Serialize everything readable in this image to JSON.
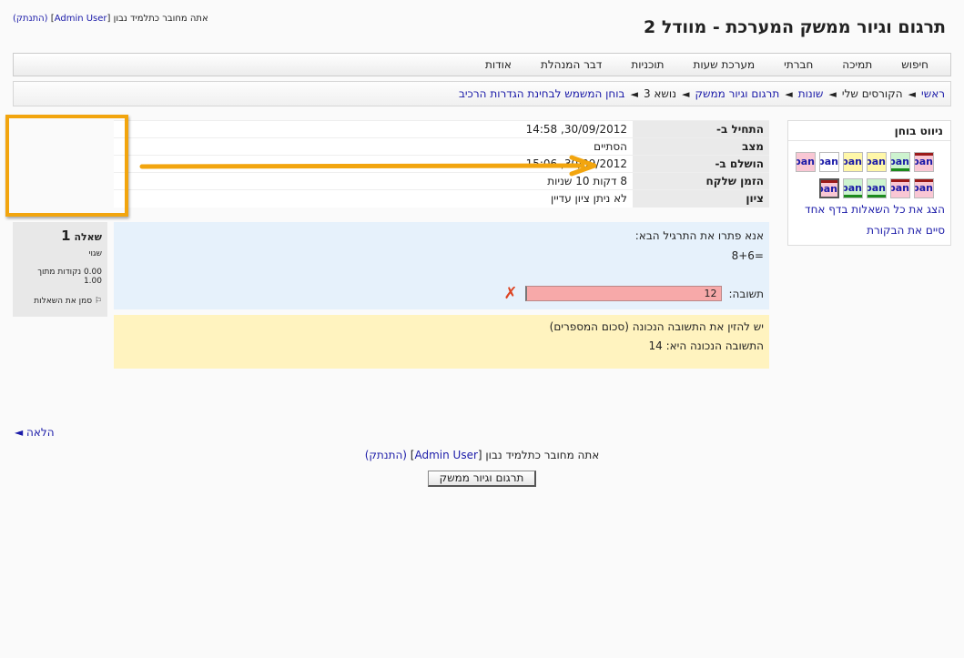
{
  "header": {
    "site_title": "תרגום וגיור ממשק המערכת - מוודל 2",
    "login_prefix": "אתה מחובר כתלמיד נבון",
    "login_user": "Admin User",
    "logout": "(התנתק)"
  },
  "menu": [
    "חיפוש",
    "תמיכה",
    "חברתי",
    "מערכת שעות",
    "תוכניות",
    "דבר המנהלת",
    "אודות"
  ],
  "breadcrumb": [
    "ראשי",
    "הקורסים שלי",
    "שונות",
    "תרגום וגיור ממשק",
    "נושא 3",
    "בוחן המשמש לבחינת הגדרות הרכיב"
  ],
  "quiz_nav": {
    "title": "ניווט בוחן",
    "buttons": [
      {
        "label": "pan",
        "bg": "#f9c7d4",
        "bar": "#9b1a1a",
        "bar_pos": "top"
      },
      {
        "label": "pan",
        "bg": "#cdf3cf",
        "bar": "#1c8a1c",
        "bar_pos": "bottom"
      },
      {
        "label": "pan",
        "bg": "#fff7a8",
        "bar": "",
        "bar_pos": ""
      },
      {
        "label": "pan",
        "bg": "#fff7a8",
        "bar": "",
        "bar_pos": ""
      },
      {
        "label": "pan",
        "bg": "#ffffff",
        "bar": "",
        "bar_pos": ""
      },
      {
        "label": "pan",
        "bg": "#f9c7d4",
        "bar": "",
        "bar_pos": ""
      },
      {
        "label": "pan",
        "bg": "#f9c7d4",
        "bar": "#9b1a1a",
        "bar_pos": "top"
      },
      {
        "label": "pan",
        "bg": "#f9c7d4",
        "bar": "#9b1a1a",
        "bar_pos": "top"
      },
      {
        "label": "pan",
        "bg": "#cdf3cf",
        "bar": "#1c8a1c",
        "bar_pos": "bottom"
      },
      {
        "label": "pan",
        "bg": "#cdf3cf",
        "bar": "#1c8a1c",
        "bar_pos": "bottom"
      },
      {
        "label": "pan",
        "bg": "#f9c7d4",
        "bar": "#9b1a1a",
        "bar_pos": "top"
      }
    ],
    "show_all": "הצג את כל השאלות בדף אחד",
    "finish_review": "סיים את הבקורת"
  },
  "summary": [
    {
      "label": "התחיל ב-",
      "value": "30/09/2012, 14:58"
    },
    {
      "label": "מצב",
      "value": "הסתיים"
    },
    {
      "label": "הושלם ב-",
      "value": "30/09/2012, 15:06"
    },
    {
      "label": "הזמן שלקח",
      "value": "8 דקות 10 שניות"
    },
    {
      "label": "ציון",
      "value": "לא ניתן ציון עדיין"
    }
  ],
  "question_info": {
    "label": "שאלה",
    "number": "1",
    "state": "שגוי",
    "grade": "0.00 נקודות מתוך 1.00",
    "flag": "סמן את השאלות"
  },
  "question": {
    "prompt": "אנא פתרו את התרגיל הבא:",
    "expression": "8+6=",
    "answer_label": "תשובה:",
    "answer_value": "12"
  },
  "feedback": {
    "general": "יש להזין את התשובה הנכונה (סכום המספרים)",
    "right_answer": "התשובה הנכונה היא: 14"
  },
  "footer": {
    "next": "הלאה ◄",
    "home_button": "תרגום וגיור ממשק"
  },
  "colors": {
    "highlight": "#f2a50e",
    "arrow": "#f2a50e",
    "incorrect": "#f7a9a9",
    "feedback": "#fff3bf",
    "question_bg": "#e6f1fb"
  }
}
